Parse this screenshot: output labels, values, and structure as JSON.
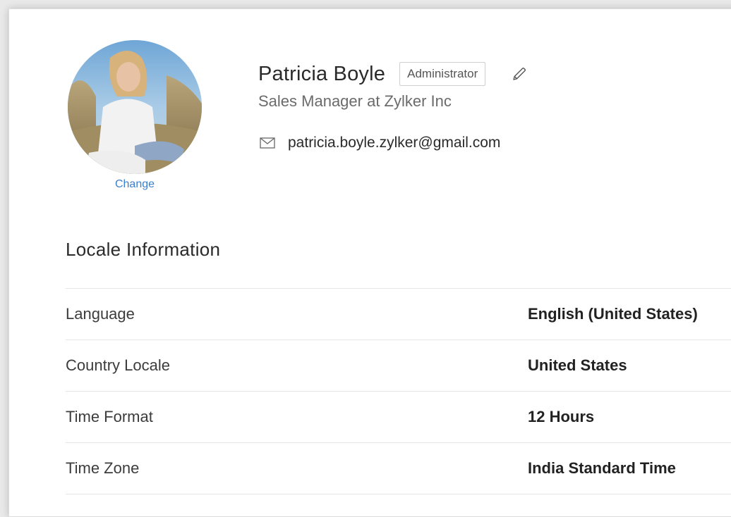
{
  "profile": {
    "name": "Patricia Boyle",
    "role": "Administrator",
    "job_title": "Sales Manager at Zylker Inc",
    "email": "patricia.boyle.zylker@gmail.com",
    "change_photo_label": "Change",
    "icons": {
      "edit": "pencil-icon",
      "email": "envelope-icon"
    }
  },
  "locale": {
    "title": "Locale Information",
    "rows": [
      {
        "label": "Language",
        "value": "English (United States)"
      },
      {
        "label": "Country Locale",
        "value": "United States"
      },
      {
        "label": "Time Format",
        "value": "12 Hours"
      },
      {
        "label": "Time Zone",
        "value": "India Standard Time"
      }
    ]
  },
  "colors": {
    "link": "#3a7fd0",
    "border": "#e6e6e6",
    "muted_text": "#6b6b6b"
  }
}
